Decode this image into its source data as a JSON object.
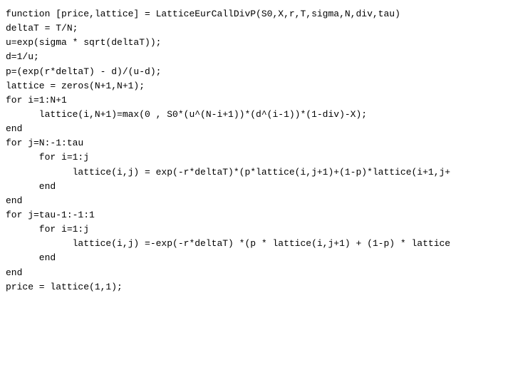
{
  "code": {
    "lines": [
      {
        "text": "function [price,lattice] = LatticeEurCallDivP(S0,X,r,T,sigma,N,div,tau)",
        "indent": 0
      },
      {
        "text": "deltaT = T/N;",
        "indent": 0
      },
      {
        "text": "u=exp(sigma * sqrt(deltaT));",
        "indent": 0
      },
      {
        "text": "d=1/u;",
        "indent": 0
      },
      {
        "text": "p=(exp(r*deltaT) - d)/(u-d);",
        "indent": 0
      },
      {
        "text": "lattice = zeros(N+1,N+1);",
        "indent": 0
      },
      {
        "text": "for i=1:N+1",
        "indent": 0
      },
      {
        "text": "   lattice(i,N+1)=max(0 , S0*(u^(N-i+1))*(d^(i-1))*(1-div)-X);",
        "indent": 1
      },
      {
        "text": "end",
        "indent": 0
      },
      {
        "text": "for j=N:-1:tau",
        "indent": 0
      },
      {
        "text": "   for i=1:j",
        "indent": 1
      },
      {
        "text": "      lattice(i,j) = exp(-r*deltaT)*(p*lattice(i,j+1)+(1-p)*lattice(i+1,j+",
        "indent": 2
      },
      {
        "text": "   end",
        "indent": 1
      },
      {
        "text": "end",
        "indent": 0
      },
      {
        "text": "for j=tau-1:-1:1",
        "indent": 0
      },
      {
        "text": "   for i=1:j",
        "indent": 1
      },
      {
        "text": "      lattice(i,j) =-exp(-r*deltaT) *(p * lattice(i,j+1) + (1-p) * lattice",
        "indent": 2
      },
      {
        "text": "   end",
        "indent": 1
      },
      {
        "text": "end",
        "indent": 0
      },
      {
        "text": "price = lattice(1,1);",
        "indent": 0
      }
    ]
  }
}
